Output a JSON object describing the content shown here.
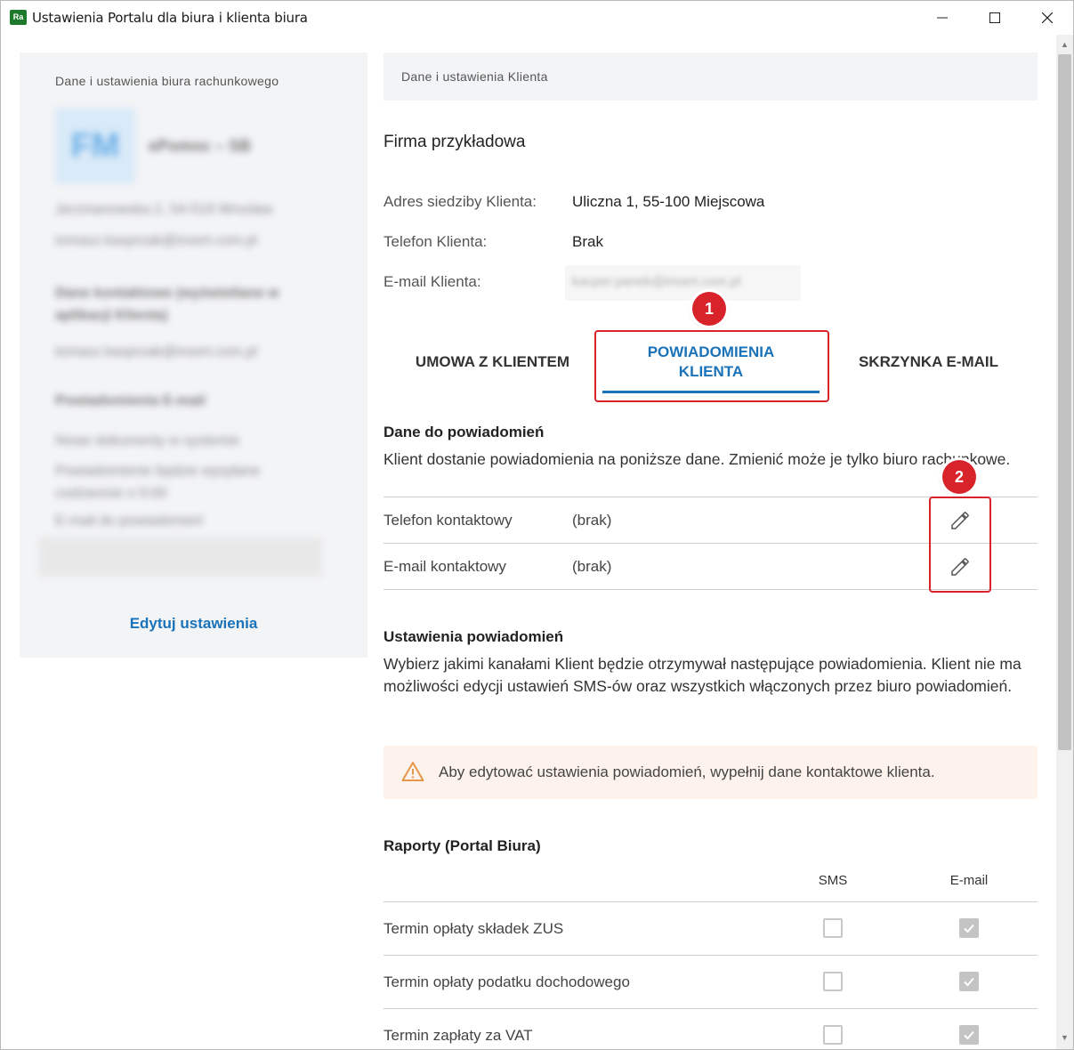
{
  "window": {
    "app_icon": "Ra",
    "title": "Ustawienia Portalu dla biura i klienta biura"
  },
  "left_panel": {
    "header": "Dane i ustawienia biura rachunkowego",
    "avatar_initials": "FM",
    "office_name": "ePomoc – SB",
    "address": "Jerzmanowska 2, 54-519 Wrocław",
    "email": "tomasz.kasprzak@insert.com.pl",
    "contact_heading": "Dane kontaktowe (wyświetlane w aplikacji Klienta)",
    "contact_email": "tomasz.kasprzak@insert.com.pl",
    "notifications_heading": "Powiadomienia E-mail",
    "new_documents": "Nowe dokumenty w systemie",
    "notification_time": "Powiadomienie będzie wysyłane codziennie o 9:00",
    "email_for_notifications": "E-mail do powiadomień",
    "edit_settings": "Edytuj ustawienia"
  },
  "client": {
    "header": "Dane i ustawienia Klienta",
    "company": "Firma przykładowa",
    "address_label": "Adres siedziby Klienta:",
    "address_value": "Uliczna 1, 55-100 Miejscowa",
    "phone_label": "Telefon Klienta:",
    "phone_value": "Brak",
    "email_label": "E-mail Klienta:",
    "email_value": "kacper.panek@insert.com.pl"
  },
  "tabs": [
    {
      "label": "UMOWA Z KLIENTEM",
      "active": false
    },
    {
      "label_line1": "POWIADOMIENIA",
      "label_line2": "KLIENTA",
      "active": true
    },
    {
      "label": "SKRZYNKA E-MAIL",
      "active": false
    }
  ],
  "annotations": {
    "badge1": "1",
    "badge2": "2"
  },
  "notification_data": {
    "title": "Dane do powiadomień",
    "description": "Klient dostanie powiadomienia na poniższe dane. Zmienić może je tylko biuro rachunkowe.",
    "rows": [
      {
        "label": "Telefon kontaktowy",
        "value": "(brak)"
      },
      {
        "label": "E-mail kontaktowy",
        "value": "(brak)"
      }
    ]
  },
  "notification_settings": {
    "title": "Ustawienia powiadomień",
    "description": "Wybierz jakimi kanałami Klient będzie otrzymywał następujące powiadomienia. Klient nie ma możliwości edycji ustawień SMS-ów oraz wszystkich włączonych przez biuro powiadomień.",
    "warning": "Aby edytować ustawienia powiadomień, wypełnij dane kontaktowe klienta."
  },
  "reports": {
    "title": "Raporty (Portal Biura)",
    "col_sms": "SMS",
    "col_email": "E-mail",
    "rows": [
      {
        "label": "Termin opłaty składek ZUS",
        "sms": false,
        "email": true
      },
      {
        "label": "Termin opłaty podatku dochodowego",
        "sms": false,
        "email": true
      },
      {
        "label": "Termin zapłaty za VAT",
        "sms": false,
        "email": true
      }
    ]
  },
  "colors": {
    "accent": "#1a72b8",
    "highlight": "#d8232a",
    "warning": "#e8964a"
  }
}
